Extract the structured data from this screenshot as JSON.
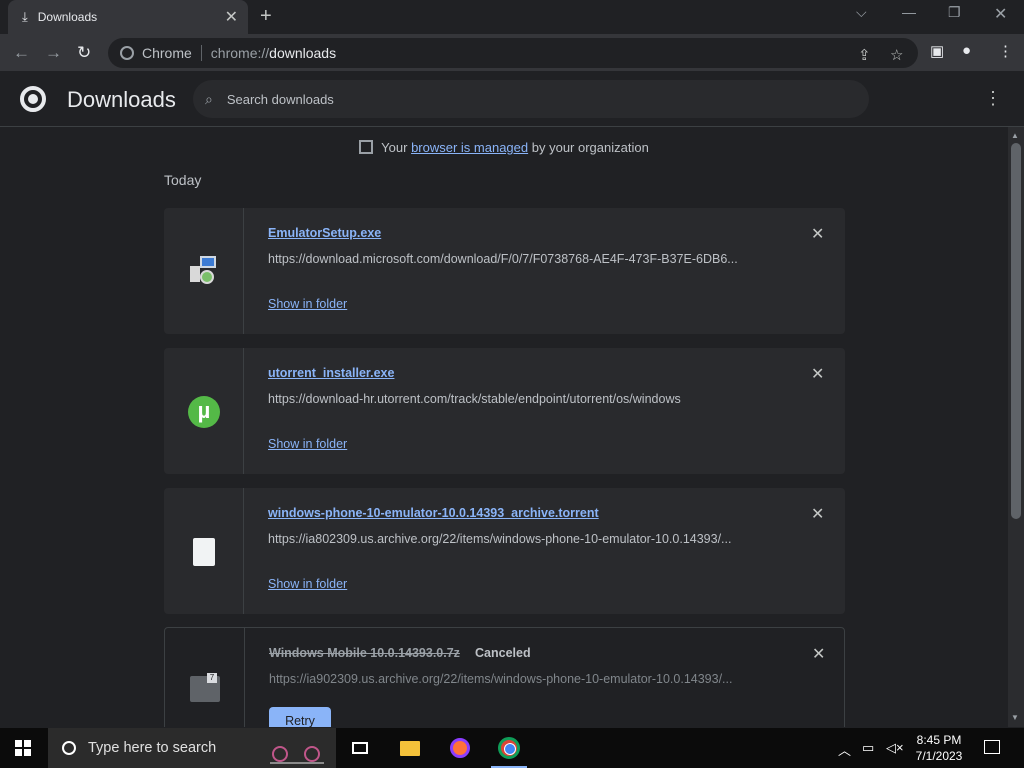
{
  "tab": {
    "title": "Downloads",
    "close": "✕",
    "new_tab": "+"
  },
  "window_controls": {
    "search_tabs": "⌵",
    "minimize": "—",
    "restore": "❐",
    "close": "✕"
  },
  "toolbar": {
    "back": "←",
    "forward": "→",
    "reload": "↻",
    "site_name": "Chrome",
    "url_scheme": "chrome://",
    "url_host": "downloads",
    "share_icon": "⇪",
    "bookmark_icon": "☆",
    "sidepanel_icon": "▣",
    "profile_icon": "●",
    "menu_icon": "⋮"
  },
  "header": {
    "title": "Downloads",
    "search_placeholder": "Search downloads",
    "search_icon": "🔍",
    "more_icon": "⋮"
  },
  "managed_notice": {
    "prefix": "Your",
    "link": "browser is managed",
    "suffix": "by your organization"
  },
  "date_group": "Today",
  "downloads": [
    {
      "file_name": "EmulatorSetup.exe",
      "url": "https://download.microsoft.com/download/F/0/7/F0738768-AE4F-473F-B37E-6DB6...",
      "action": "Show in folder",
      "icon": "installer-icon"
    },
    {
      "file_name": "utorrent_installer.exe",
      "url": "https://download-hr.utorrent.com/track/stable/endpoint/utorrent/os/windows",
      "action": "Show in folder",
      "icon": "utorrent-icon"
    },
    {
      "file_name": "windows-phone-10-emulator-10.0.14393_archive.torrent",
      "url": "https://ia802309.us.archive.org/22/items/windows-phone-10-emulator-10.0.14393/...",
      "action": "Show in folder",
      "icon": "document-icon"
    },
    {
      "file_name": "Windows Mobile 10.0.14393.0.7z",
      "status": "Canceled",
      "url": "https://ia902309.us.archive.org/22/items/windows-phone-10-emulator-10.0.14393/...",
      "action": "Retry",
      "icon": "archive-icon",
      "icon_badge": "7"
    }
  ],
  "close_glyph": "✕",
  "taskbar": {
    "search_placeholder": "Type here to search",
    "time": "8:45 PM",
    "date": "7/1/2023",
    "tray_chevron": "︿"
  },
  "colors": {
    "accent": "#8ab4f8",
    "background": "#202124",
    "card": "#292a2d"
  }
}
